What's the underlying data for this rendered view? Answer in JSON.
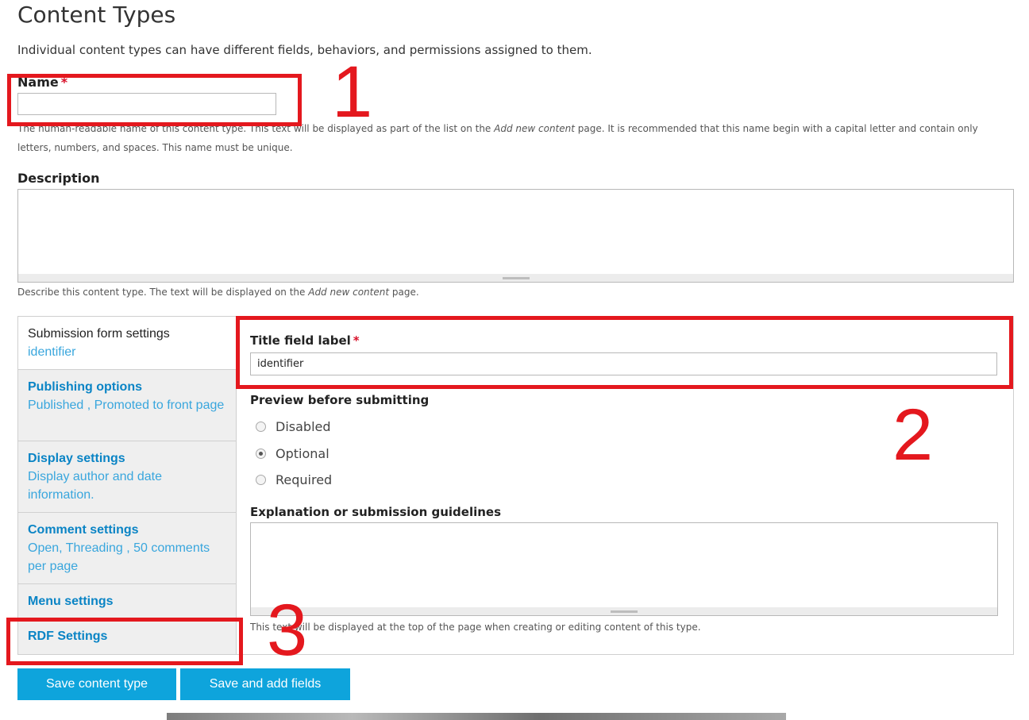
{
  "page": {
    "title": "Content Types",
    "intro": "Individual content types can have different fields, behaviors, and permissions assigned to them."
  },
  "name_field": {
    "label": "Name",
    "required_mark": "*",
    "value": "",
    "help_before": "The human-readable name of this content type. This text will be displayed as part of the list on the ",
    "help_link": "Add new content",
    "help_after": " page. It is recommended that this name begin with a capital letter and contain only letters, numbers, and spaces. This name must be unique."
  },
  "description_field": {
    "label": "Description",
    "value": "",
    "help_before": "Describe this content type. The text will be displayed on the ",
    "help_link": "Add new content",
    "help_after": " page."
  },
  "vertical_tabs": [
    {
      "title": "Submission form settings",
      "summary": "identifier"
    },
    {
      "title": "Publishing options",
      "summary": "Published , Promoted to front page"
    },
    {
      "title": "Display settings",
      "summary": "Display author and date information."
    },
    {
      "title": "Comment settings",
      "summary": "Open, Threading , 50 comments per page"
    },
    {
      "title": "Menu settings",
      "summary": ""
    },
    {
      "title": "RDF Settings",
      "summary": ""
    }
  ],
  "submission_pane": {
    "title_label": "Title field label",
    "required_mark": "*",
    "title_value": "identifier",
    "preview_label": "Preview before submitting",
    "preview_options": [
      {
        "label": "Disabled",
        "selected": false
      },
      {
        "label": "Optional",
        "selected": true
      },
      {
        "label": "Required",
        "selected": false
      }
    ],
    "guidelines_label": "Explanation or submission guidelines",
    "guidelines_value": "",
    "guidelines_help": "This text will be displayed at the top of the page when creating or editing content of this type."
  },
  "buttons": {
    "save": "Save content type",
    "save_and_add": "Save and add fields"
  },
  "annotations": {
    "one": "1",
    "two": "2",
    "three": "3",
    "color": "#e4181e"
  },
  "colors": {
    "accent": "#0ea4dc",
    "link": "#0a84c5",
    "required": "#d8112a"
  }
}
